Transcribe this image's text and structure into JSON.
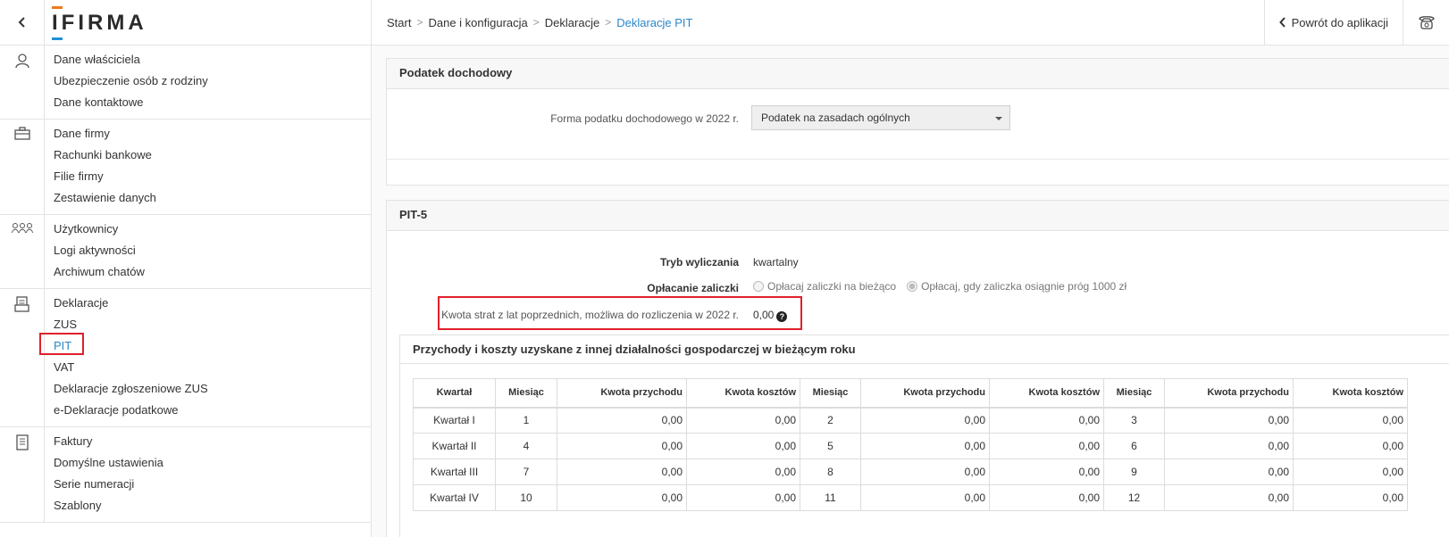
{
  "app": {
    "logo_text": "IFIRMA",
    "logo_colors": {
      "orange": "#f07a1a",
      "blue": "#1e90d8"
    }
  },
  "topbar": {
    "breadcrumb": [
      "Start",
      "Dane i konfiguracja",
      "Deklaracje",
      "Deklaracje PIT"
    ],
    "back_label": "Powrót do aplikacji",
    "phone_icon": "phone-icon"
  },
  "sidebar": {
    "groups": [
      {
        "icon": "user-icon",
        "items": [
          "Dane właściciela",
          "Ubezpieczenie osób z rodziny",
          "Dane kontaktowe"
        ]
      },
      {
        "icon": "briefcase-icon",
        "items": [
          "Dane firmy",
          "Rachunki bankowe",
          "Filie firmy",
          "Zestawienie danych"
        ]
      },
      {
        "icon": "users-icon",
        "items": [
          "Użytkownicy",
          "Logi aktywności",
          "Archiwum chatów"
        ]
      },
      {
        "icon": "declarations-icon",
        "items": [
          "Deklaracje",
          "ZUS",
          "PIT",
          "VAT",
          "Deklaracje zgłoszeniowe ZUS",
          "e-Deklaracje podatkowe"
        ]
      },
      {
        "icon": "invoice-icon",
        "items": [
          "Faktury",
          "Domyślne ustawienia",
          "Serie numeracji",
          "Szablony"
        ]
      }
    ],
    "active_item": "PIT",
    "accent": "#2a87c9"
  },
  "income_tax": {
    "title": "Podatek dochodowy",
    "form_label": "Forma podatku dochodowego w 2022 r.",
    "form_value": "Podatek na zasadach ogólnych"
  },
  "pit5": {
    "title": "PIT-5",
    "mode_label": "Tryb wyliczania",
    "mode_value": "kwartalny",
    "payment_label": "Opłacanie zaliczki",
    "payment_options": [
      "Opłacaj zaliczki na bieżąco",
      "Opłacaj, gdy zaliczka osiągnie próg 1000 zł"
    ],
    "payment_selected": 1,
    "losses_label": "Kwota strat z lat poprzednich, możliwa do rozliczenia w 2022 r.",
    "losses_value": "0,00",
    "highlight_color": "#e0202a"
  },
  "other_activity": {
    "title": "Przychody i koszty uzyskane z innej działalności gospodarczej w bieżącym roku",
    "headers": [
      "Kwartał",
      "Miesiąc",
      "Kwota przychodu",
      "Kwota kosztów",
      "Miesiąc",
      "Kwota przychodu",
      "Kwota kosztów",
      "Miesiąc",
      "Kwota przychodu",
      "Kwota kosztów"
    ],
    "rows": [
      [
        "Kwartał I",
        "1",
        "0,00",
        "0,00",
        "2",
        "0,00",
        "0,00",
        "3",
        "0,00",
        "0,00"
      ],
      [
        "Kwartał II",
        "4",
        "0,00",
        "0,00",
        "5",
        "0,00",
        "0,00",
        "6",
        "0,00",
        "0,00"
      ],
      [
        "Kwartał III",
        "7",
        "0,00",
        "0,00",
        "8",
        "0,00",
        "0,00",
        "9",
        "0,00",
        "0,00"
      ],
      [
        "Kwartał IV",
        "10",
        "0,00",
        "0,00",
        "11",
        "0,00",
        "0,00",
        "12",
        "0,00",
        "0,00"
      ]
    ]
  }
}
